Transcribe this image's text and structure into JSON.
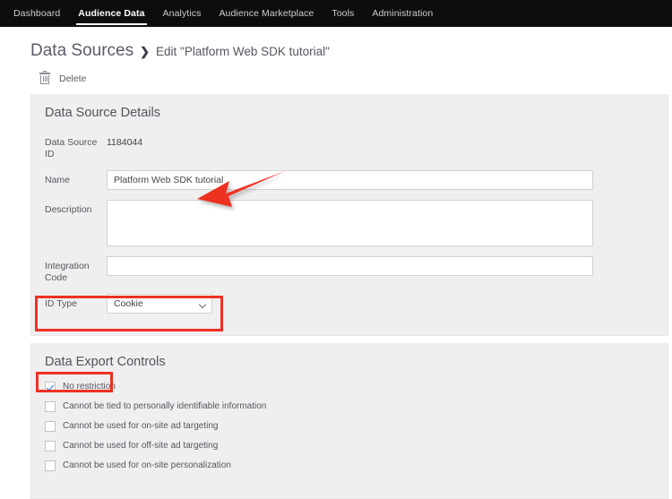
{
  "topnav": {
    "items": [
      {
        "label": "Dashboard",
        "active": false
      },
      {
        "label": "Audience Data",
        "active": true
      },
      {
        "label": "Analytics",
        "active": false
      },
      {
        "label": "Audience Marketplace",
        "active": false
      },
      {
        "label": "Tools",
        "active": false
      },
      {
        "label": "Administration",
        "active": false
      }
    ]
  },
  "breadcrumb": {
    "root": "Data Sources",
    "separator": "❯",
    "current": "Edit \"Platform Web SDK tutorial\""
  },
  "toolbar": {
    "delete_label": "Delete",
    "delete_icon": "trash-icon"
  },
  "details": {
    "title": "Data Source Details",
    "fields": {
      "data_source_id": {
        "label": "Data Source ID",
        "value": "1184044"
      },
      "name": {
        "label": "Name",
        "value": "Platform Web SDK tutorial",
        "placeholder": ""
      },
      "description": {
        "label": "Description",
        "value": "",
        "placeholder": ""
      },
      "integration_code": {
        "label": "Integration Code",
        "value": "",
        "placeholder": ""
      },
      "id_type": {
        "label": "ID Type",
        "value": "Cookie",
        "chevron_icon": "chevron-down-icon"
      }
    }
  },
  "export_controls": {
    "title": "Data Export Controls",
    "options": [
      {
        "label": "No restriction",
        "checked": true
      },
      {
        "label": "Cannot be tied to personally identifiable information",
        "checked": false
      },
      {
        "label": "Cannot be used for on-site ad targeting",
        "checked": false
      },
      {
        "label": "Cannot be used for off-site ad targeting",
        "checked": false
      },
      {
        "label": "Cannot be used for on-site personalization",
        "checked": false
      }
    ]
  },
  "annotations": {
    "highlight_color": "#EE3124",
    "arrow": {
      "name": "red-arrow-pointing-to-name-field",
      "direction": "down-left"
    },
    "boxes": [
      {
        "name": "id-type-highlight"
      },
      {
        "name": "no-restriction-highlight"
      }
    ]
  },
  "colors": {
    "nav_background": "#0D0D0D",
    "panel_background": "#EFEFF0",
    "page_background": "#FFFFFF",
    "checkbox_check": "#1473E6",
    "annotation_red": "#EE3124"
  }
}
